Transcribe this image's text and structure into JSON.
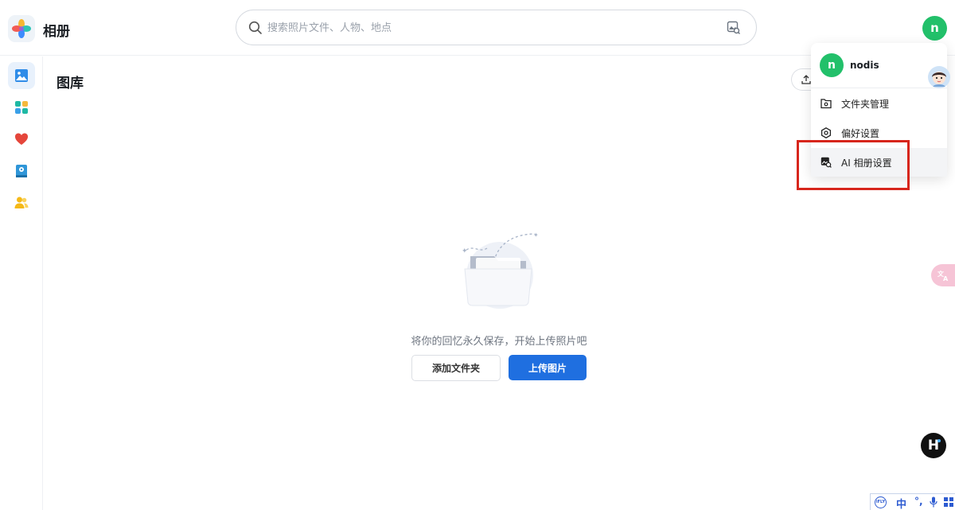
{
  "app": {
    "title": "相册",
    "logo_icon": "photos-flower-icon"
  },
  "search": {
    "placeholder": "搜索照片文件、人物、地点",
    "value": ""
  },
  "user": {
    "initial": "n",
    "name": "nodis",
    "avatar_color": "#22c06a"
  },
  "sidebar": {
    "items": [
      {
        "icon": "gallery-icon",
        "active": true
      },
      {
        "icon": "albums-icon",
        "active": false
      },
      {
        "icon": "favorites-heart-icon",
        "active": false
      },
      {
        "icon": "memories-book-icon",
        "active": false
      },
      {
        "icon": "people-icon",
        "active": false
      }
    ]
  },
  "main": {
    "title": "图库",
    "empty_message": "将你的回忆永久保存，开始上传照片吧",
    "add_folder_label": "添加文件夹",
    "upload_label": "上传图片"
  },
  "dropdown": {
    "items": [
      {
        "label": "文件夹管理",
        "icon": "folder-settings-icon"
      },
      {
        "label": "偏好设置",
        "icon": "gear-icon"
      },
      {
        "label": "AI 相册设置",
        "icon": "ai-album-settings-icon"
      }
    ]
  },
  "widgets": {
    "assistant_badge": "H",
    "ime_zh": "中",
    "ime_punct": "°,"
  },
  "colors": {
    "primary": "#1f6fe0",
    "highlight_border": "#d7261c",
    "active_bg": "#e8f1fc"
  }
}
